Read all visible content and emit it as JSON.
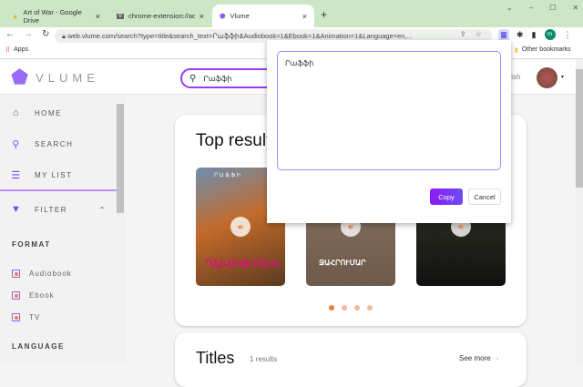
{
  "browser": {
    "tabs": [
      {
        "title": "Art of War - Google Drive"
      },
      {
        "title": "chrome-extension://adioimbicr"
      },
      {
        "title": "Vlume"
      }
    ],
    "url": "web.vlume.com/search?type=title&search_text=Րաֆֆի&Audiobook=1&Ebook=1&Animation=1&Language=en,...",
    "profile_initial": "m",
    "bookmarks": {
      "apps": "Apps",
      "other": "Other bookmarks"
    }
  },
  "header": {
    "logo": "VLUME",
    "search_value": "Րաֆֆի",
    "language": "glish"
  },
  "sidebar": {
    "nav": [
      {
        "label": "HOME",
        "icon": "home-icon"
      },
      {
        "label": "SEARCH",
        "icon": "search-icon"
      },
      {
        "label": "MY LIST",
        "icon": "list-icon"
      }
    ],
    "filter": "FILTER",
    "format_heading": "FORMAT",
    "formats": [
      {
        "label": "Audiobook",
        "checked": true
      },
      {
        "label": "Ebook",
        "checked": true
      },
      {
        "label": "TV",
        "checked": true
      }
    ],
    "language_heading": "LANGUAGE"
  },
  "main": {
    "top_results_title": "Top results",
    "covers": [
      {
        "title": "ԴԱՎԻԹ ԲԵԿ",
        "author": "Ր Ա Ֆ Ֆ Ի"
      },
      {
        "title": "ՋԱՀՐՈՒՄԱՐ"
      },
      {
        "title": ""
      }
    ],
    "carousel_pages": 4,
    "carousel_active": 1,
    "titles_heading": "Titles",
    "titles_count": "1 results",
    "see_more": "See more"
  },
  "popup": {
    "text": "Րաֆֆի",
    "copy": "Copy",
    "cancel": "Cancel"
  },
  "colors": {
    "accent": "#8a3ffc",
    "orange": "#f07f3c",
    "tabstrip": "#cde7c6"
  }
}
